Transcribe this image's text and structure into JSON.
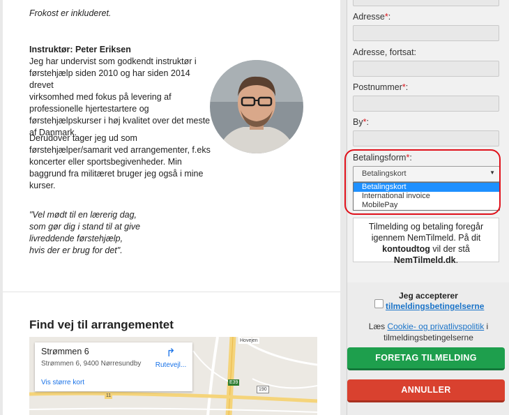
{
  "content": {
    "intro": "Frokost er inkluderet.",
    "instructor_title": "Instruktør: Peter Eriksen",
    "bio_lines": [
      "Jeg har undervist som godkendt instruktør i",
      "førstehjælp siden 2010 og har siden 2014 drevet",
      "virksomhed med fokus på levering af",
      "professionelle hjertestartere og",
      "førstehjælpskurser i høj kvalitet over det meste",
      "af Danmark."
    ],
    "bio2_lines": [
      "Derudover tager jeg ud som",
      "førstehjælper/samarit ved arrangementer, f.eks",
      "koncerter eller sportsbegivenheder. Min",
      "baggrund fra militæret bruger jeg også i mine kurser."
    ],
    "quote_lines": [
      "\"Vel mødt til en lærerig dag,",
      "som gør dig i stand til at give",
      "livreddende førstehjælp,",
      "hvis der er brug for det\"."
    ]
  },
  "map": {
    "section_title": "Find vej til arrangementet",
    "place_name": "Strømmen 6",
    "address": "Strømmen 6, 9400 Nørresundby",
    "directions": "Rutevejl...",
    "larger_map": "Vis større kort",
    "road_labels": [
      "Hovejen",
      "E39",
      "190",
      "11"
    ]
  },
  "form": {
    "address_label": "Adresse",
    "address2_label": "Adresse, fortsat:",
    "postal_label": "Postnummer",
    "city_label": "By",
    "payment_label": "Betalingsform",
    "required_mark": "*",
    "colon": ":",
    "payment_selected": "Betalingskort",
    "payment_options": [
      "Betalingskort",
      "International invoice",
      "MobilePay"
    ],
    "info_text_1": "Tilmelding og betaling foregår igennem NemTilmeld. På dit ",
    "info_bold_1": "kontoudtog",
    "info_text_2": " vil der stå ",
    "info_bold_2": "NemTilmeld.dk",
    "info_text_3": ".",
    "accept_title": "Jeg accepterer",
    "terms_link": "tilmeldingsbetingelserne",
    "note_prefix": "Læs ",
    "note_link": "Cookie- og privatlivspolitik",
    "note_suffix": " i tilmeldingsbetingelserne",
    "submit_label": "FORETAG TILMELDING",
    "cancel_label": "ANNULLER"
  },
  "colors": {
    "required": "#d8141b",
    "submit": "#1e9f4d",
    "cancel": "#d9412f",
    "highlight": "#e0101a",
    "selected_option": "#1e90ff"
  }
}
